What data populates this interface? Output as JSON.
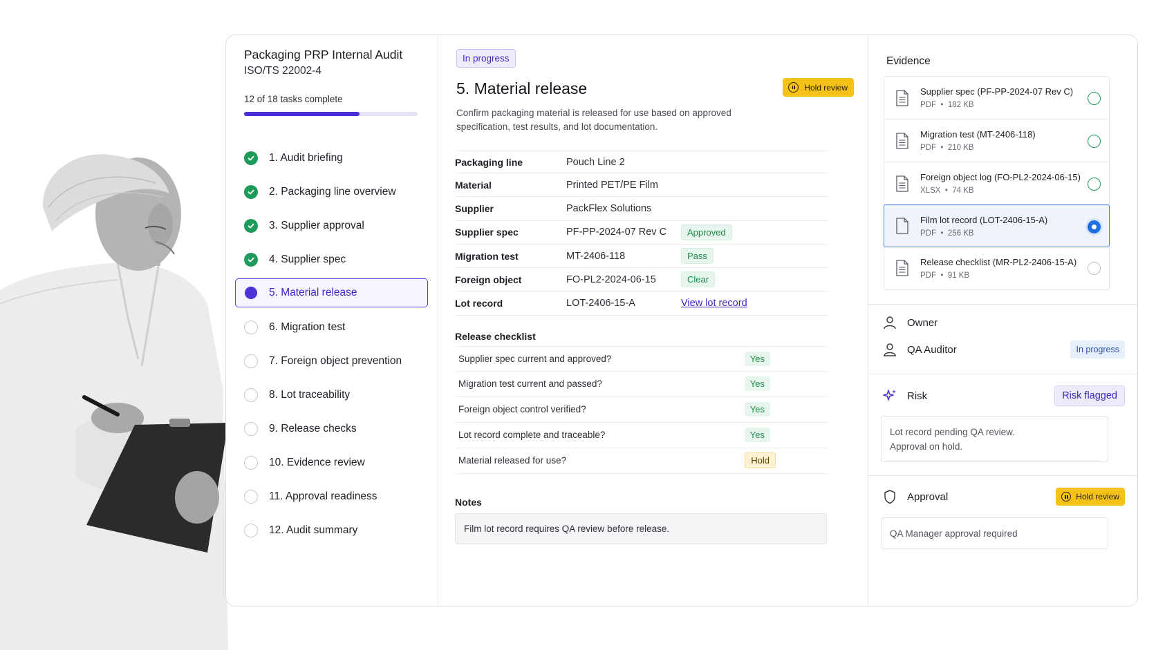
{
  "audit": {
    "title": "Packaging PRP Internal Audit",
    "standard": "ISO/TS 22002-4",
    "progress_text": "12 of 18 tasks complete",
    "progress_fraction": 0.667
  },
  "tasks": [
    {
      "label": "1. Audit briefing",
      "status": "done"
    },
    {
      "label": "2. Packaging line overview",
      "status": "done"
    },
    {
      "label": "3. Supplier approval",
      "status": "done"
    },
    {
      "label": "4. Supplier spec",
      "status": "done"
    },
    {
      "label": "5. Material release",
      "status": "current"
    },
    {
      "label": "6. Migration test",
      "status": "todo"
    },
    {
      "label": "7. Foreign object prevention",
      "status": "todo"
    },
    {
      "label": "8. Lot traceability",
      "status": "todo"
    },
    {
      "label": "9. Release checks",
      "status": "todo"
    },
    {
      "label": "10. Evidence review",
      "status": "todo"
    },
    {
      "label": "11. Approval readiness",
      "status": "todo"
    },
    {
      "label": "12. Audit summary",
      "status": "todo"
    }
  ],
  "main": {
    "status_badge": "In progress",
    "title": "5. Material release",
    "hold_button": "Hold review",
    "description": "Confirm packaging material is released for use based on approved specification, test results, and lot documentation.",
    "details": [
      {
        "key": "Packaging line",
        "value": "Pouch Line 2",
        "tag": ""
      },
      {
        "key": "Material",
        "value": "Printed PET/PE Film",
        "tag": ""
      },
      {
        "key": "Supplier",
        "value": "PackFlex Solutions",
        "tag": ""
      },
      {
        "key": "Supplier spec",
        "value": "PF-PP-2024-07 Rev C",
        "tag": "Approved"
      },
      {
        "key": "Migration test",
        "value": "MT-2406-118",
        "tag": "Pass"
      },
      {
        "key": "Foreign object",
        "value": "FO-PL2-2024-06-15",
        "tag": "Clear"
      },
      {
        "key": "Lot record",
        "value": "LOT-2406-15-A",
        "link": "View lot record"
      }
    ],
    "checklist_label": "Release checklist",
    "checklist": [
      {
        "question": "Supplier spec current and approved?",
        "answer": "Yes",
        "kind": "yes"
      },
      {
        "question": "Migration test current and passed?",
        "answer": "Yes",
        "kind": "yes"
      },
      {
        "question": "Foreign object control verified?",
        "answer": "Yes",
        "kind": "yes"
      },
      {
        "question": "Lot record complete and traceable?",
        "answer": "Yes",
        "kind": "yes"
      },
      {
        "question": "Material released for use?",
        "answer": "Hold",
        "kind": "hold"
      }
    ],
    "notes_label": "Notes",
    "notes": "Film lot record requires QA review before release."
  },
  "evidence": {
    "heading": "Evidence",
    "items": [
      {
        "name": "Supplier spec (PF-PP-2024-07 Rev C)",
        "type": "PDF",
        "size": "182 KB",
        "state": "verified"
      },
      {
        "name": "Migration test (MT-2406-118)",
        "type": "PDF",
        "size": "210 KB",
        "state": "verified"
      },
      {
        "name": "Foreign object log (FO-PL2-2024-06-15)",
        "type": "XLSX",
        "size": "74 KB",
        "state": "verified"
      },
      {
        "name": "Film lot record (LOT-2406-15-A)",
        "type": "PDF",
        "size": "256 KB",
        "state": "selected"
      },
      {
        "name": "Release checklist (MR-PL2-2406-15-A)",
        "type": "PDF",
        "size": "91 KB",
        "state": "empty"
      }
    ]
  },
  "sidebar_right": {
    "owner_label": "Owner",
    "auditor_label": "QA Auditor",
    "auditor_status": "In progress",
    "risk_label": "Risk",
    "risk_badge": "Risk flagged",
    "risk_note_line1": "Lot record pending QA review.",
    "risk_note_line2": "Approval on hold.",
    "approval_label": "Approval",
    "approval_badge": "Hold review",
    "approval_note": "QA Manager approval required"
  },
  "colors": {
    "accent": "#4b30d6",
    "success": "#1e9a5a",
    "warning": "#f5c21a",
    "selected_blue": "#1f6fe0"
  }
}
